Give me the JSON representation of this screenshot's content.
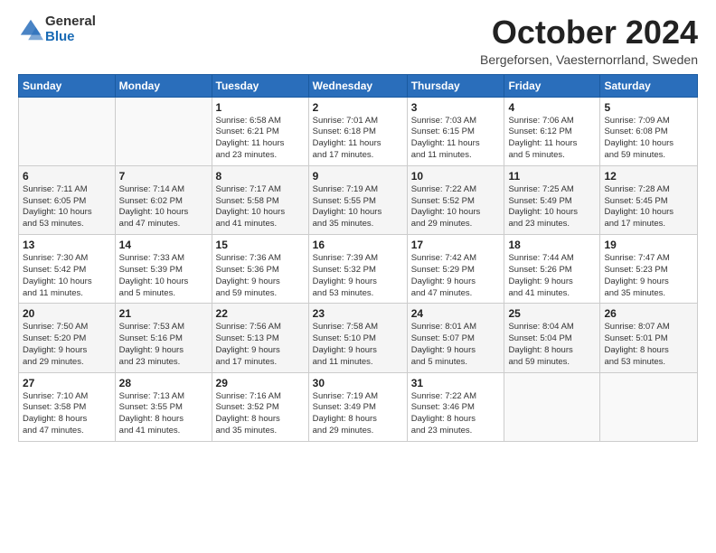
{
  "header": {
    "logo_general": "General",
    "logo_blue": "Blue",
    "month_title": "October 2024",
    "subtitle": "Bergeforsen, Vaesternorrland, Sweden"
  },
  "weekdays": [
    "Sunday",
    "Monday",
    "Tuesday",
    "Wednesday",
    "Thursday",
    "Friday",
    "Saturday"
  ],
  "weeks": [
    [
      {
        "day": "",
        "detail": ""
      },
      {
        "day": "",
        "detail": ""
      },
      {
        "day": "1",
        "detail": "Sunrise: 6:58 AM\nSunset: 6:21 PM\nDaylight: 11 hours\nand 23 minutes."
      },
      {
        "day": "2",
        "detail": "Sunrise: 7:01 AM\nSunset: 6:18 PM\nDaylight: 11 hours\nand 17 minutes."
      },
      {
        "day": "3",
        "detail": "Sunrise: 7:03 AM\nSunset: 6:15 PM\nDaylight: 11 hours\nand 11 minutes."
      },
      {
        "day": "4",
        "detail": "Sunrise: 7:06 AM\nSunset: 6:12 PM\nDaylight: 11 hours\nand 5 minutes."
      },
      {
        "day": "5",
        "detail": "Sunrise: 7:09 AM\nSunset: 6:08 PM\nDaylight: 10 hours\nand 59 minutes."
      }
    ],
    [
      {
        "day": "6",
        "detail": "Sunrise: 7:11 AM\nSunset: 6:05 PM\nDaylight: 10 hours\nand 53 minutes."
      },
      {
        "day": "7",
        "detail": "Sunrise: 7:14 AM\nSunset: 6:02 PM\nDaylight: 10 hours\nand 47 minutes."
      },
      {
        "day": "8",
        "detail": "Sunrise: 7:17 AM\nSunset: 5:58 PM\nDaylight: 10 hours\nand 41 minutes."
      },
      {
        "day": "9",
        "detail": "Sunrise: 7:19 AM\nSunset: 5:55 PM\nDaylight: 10 hours\nand 35 minutes."
      },
      {
        "day": "10",
        "detail": "Sunrise: 7:22 AM\nSunset: 5:52 PM\nDaylight: 10 hours\nand 29 minutes."
      },
      {
        "day": "11",
        "detail": "Sunrise: 7:25 AM\nSunset: 5:49 PM\nDaylight: 10 hours\nand 23 minutes."
      },
      {
        "day": "12",
        "detail": "Sunrise: 7:28 AM\nSunset: 5:45 PM\nDaylight: 10 hours\nand 17 minutes."
      }
    ],
    [
      {
        "day": "13",
        "detail": "Sunrise: 7:30 AM\nSunset: 5:42 PM\nDaylight: 10 hours\nand 11 minutes."
      },
      {
        "day": "14",
        "detail": "Sunrise: 7:33 AM\nSunset: 5:39 PM\nDaylight: 10 hours\nand 5 minutes."
      },
      {
        "day": "15",
        "detail": "Sunrise: 7:36 AM\nSunset: 5:36 PM\nDaylight: 9 hours\nand 59 minutes."
      },
      {
        "day": "16",
        "detail": "Sunrise: 7:39 AM\nSunset: 5:32 PM\nDaylight: 9 hours\nand 53 minutes."
      },
      {
        "day": "17",
        "detail": "Sunrise: 7:42 AM\nSunset: 5:29 PM\nDaylight: 9 hours\nand 47 minutes."
      },
      {
        "day": "18",
        "detail": "Sunrise: 7:44 AM\nSunset: 5:26 PM\nDaylight: 9 hours\nand 41 minutes."
      },
      {
        "day": "19",
        "detail": "Sunrise: 7:47 AM\nSunset: 5:23 PM\nDaylight: 9 hours\nand 35 minutes."
      }
    ],
    [
      {
        "day": "20",
        "detail": "Sunrise: 7:50 AM\nSunset: 5:20 PM\nDaylight: 9 hours\nand 29 minutes."
      },
      {
        "day": "21",
        "detail": "Sunrise: 7:53 AM\nSunset: 5:16 PM\nDaylight: 9 hours\nand 23 minutes."
      },
      {
        "day": "22",
        "detail": "Sunrise: 7:56 AM\nSunset: 5:13 PM\nDaylight: 9 hours\nand 17 minutes."
      },
      {
        "day": "23",
        "detail": "Sunrise: 7:58 AM\nSunset: 5:10 PM\nDaylight: 9 hours\nand 11 minutes."
      },
      {
        "day": "24",
        "detail": "Sunrise: 8:01 AM\nSunset: 5:07 PM\nDaylight: 9 hours\nand 5 minutes."
      },
      {
        "day": "25",
        "detail": "Sunrise: 8:04 AM\nSunset: 5:04 PM\nDaylight: 8 hours\nand 59 minutes."
      },
      {
        "day": "26",
        "detail": "Sunrise: 8:07 AM\nSunset: 5:01 PM\nDaylight: 8 hours\nand 53 minutes."
      }
    ],
    [
      {
        "day": "27",
        "detail": "Sunrise: 7:10 AM\nSunset: 3:58 PM\nDaylight: 8 hours\nand 47 minutes."
      },
      {
        "day": "28",
        "detail": "Sunrise: 7:13 AM\nSunset: 3:55 PM\nDaylight: 8 hours\nand 41 minutes."
      },
      {
        "day": "29",
        "detail": "Sunrise: 7:16 AM\nSunset: 3:52 PM\nDaylight: 8 hours\nand 35 minutes."
      },
      {
        "day": "30",
        "detail": "Sunrise: 7:19 AM\nSunset: 3:49 PM\nDaylight: 8 hours\nand 29 minutes."
      },
      {
        "day": "31",
        "detail": "Sunrise: 7:22 AM\nSunset: 3:46 PM\nDaylight: 8 hours\nand 23 minutes."
      },
      {
        "day": "",
        "detail": ""
      },
      {
        "day": "",
        "detail": ""
      }
    ]
  ]
}
